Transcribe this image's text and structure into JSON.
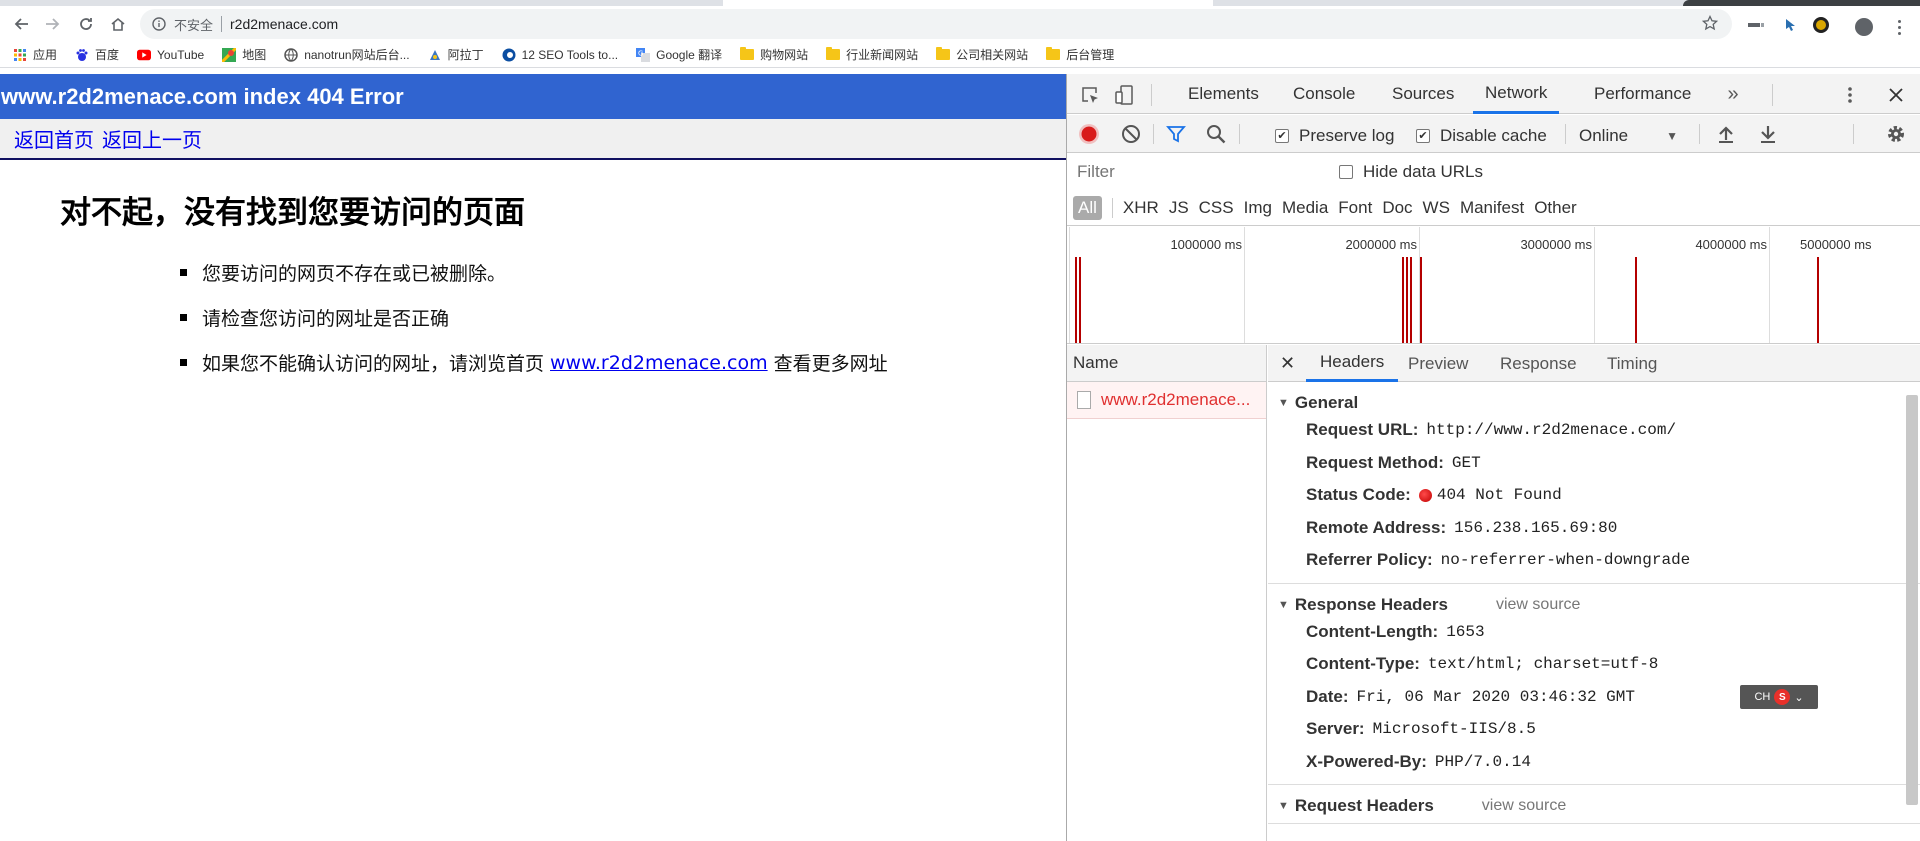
{
  "browser": {
    "security_label": "不安全",
    "url": "r2d2menace.com"
  },
  "bookmarks": [
    {
      "label": "应用",
      "icon": "apps-grid-icon"
    },
    {
      "label": "百度",
      "icon": "baidu-icon"
    },
    {
      "label": "YouTube",
      "icon": "youtube-icon"
    },
    {
      "label": "地图",
      "icon": "maps-icon"
    },
    {
      "label": "nanotrun网站后台...",
      "icon": "globe-icon"
    },
    {
      "label": "阿拉丁",
      "icon": "aladdin-icon"
    },
    {
      "label": "12 SEO Tools to...",
      "icon": "seo-icon"
    },
    {
      "label": "Google 翻译",
      "icon": "translate-icon"
    },
    {
      "label": "购物网站",
      "icon": "folder-icon"
    },
    {
      "label": "行业新闻网站",
      "icon": "folder-icon"
    },
    {
      "label": "公司相关网站",
      "icon": "folder-icon"
    },
    {
      "label": "后台管理",
      "icon": "folder-icon"
    }
  ],
  "page": {
    "header_title": "www.r2d2menace.com index 404 Error",
    "nav_home": "返回首页",
    "nav_back": "返回上一页",
    "heading": "对不起，没有找到您要访问的页面",
    "item1": "您要访问的网页不存在或已被删除。",
    "item2": "请检查您访问的网址是否正确",
    "item3_before": "如果您不能确认访问的网址，请浏览首页",
    "item3_link": "www.r2d2menace.com",
    "item3_after": "查看更多网址"
  },
  "devtools": {
    "tabs": [
      "Elements",
      "Console",
      "Sources",
      "Network",
      "Performance"
    ],
    "active_tab": "Network",
    "preserve_log": "Preserve log",
    "disable_cache": "Disable cache",
    "throttle": "Online",
    "filter_placeholder": "Filter",
    "hide_data_urls": "Hide data URLs",
    "types": [
      "All",
      "XHR",
      "JS",
      "CSS",
      "Img",
      "Media",
      "Font",
      "Doc",
      "WS",
      "Manifest",
      "Other"
    ],
    "timeline_ticks": [
      "1000000 ms",
      "2000000 ms",
      "3000000 ms",
      "4000000 ms",
      "5000000 ms"
    ],
    "name_header": "Name",
    "request_name": "www.r2d2menace...",
    "detail_tabs": [
      "Headers",
      "Preview",
      "Response",
      "Timing"
    ],
    "general": {
      "title": "General",
      "request_url_k": "Request URL:",
      "request_url_v": "http://www.r2d2menace.com/",
      "request_method_k": "Request Method:",
      "request_method_v": "GET",
      "status_code_k": "Status Code:",
      "status_code_v": "404 Not Found",
      "remote_address_k": "Remote Address:",
      "remote_address_v": "156.238.165.69:80",
      "referrer_policy_k": "Referrer Policy:",
      "referrer_policy_v": "no-referrer-when-downgrade"
    },
    "response_headers": {
      "title": "Response Headers",
      "view_source": "view source",
      "content_length_k": "Content-Length:",
      "content_length_v": "1653",
      "content_type_k": "Content-Type:",
      "content_type_v": "text/html; charset=utf-8",
      "date_k": "Date:",
      "date_v": "Fri, 06 Mar 2020 03:46:32 GMT",
      "server_k": "Server:",
      "server_v": "Microsoft-IIS/8.5",
      "powered_by_k": "X-Powered-By:",
      "powered_by_v": "PHP/7.0.14"
    },
    "request_headers": {
      "title": "Request Headers",
      "view_source": "view source"
    },
    "ime_badge": "CH",
    "ime_s": "S"
  },
  "colors": {
    "page_header_bg": "#3064d0",
    "devtools_accent": "#1a73e8",
    "error_red": "#e03030"
  }
}
